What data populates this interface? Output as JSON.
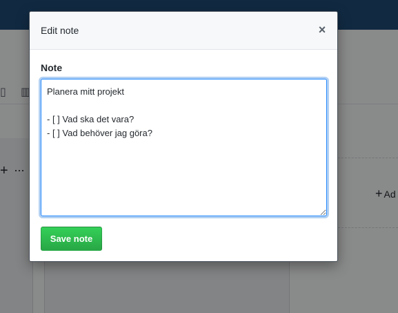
{
  "background": {
    "add_label": "Ad",
    "plus_glyph": "+",
    "dots_glyph": "···"
  },
  "modal": {
    "title": "Edit note",
    "close_glyph": "×",
    "note_label": "Note",
    "note_value": "Planera mitt projekt\n\n- [ ] Vad ska det vara?\n- [ ] Vad behöver jag göra?",
    "save_label": "Save note"
  },
  "icons": {
    "close": "close-icon",
    "plus": "plus-icon",
    "more": "kebab-horizontal-icon"
  },
  "colors": {
    "header_bg": "#1f4e79",
    "focus_border": "#2188ff",
    "save_button": "#28a745"
  }
}
